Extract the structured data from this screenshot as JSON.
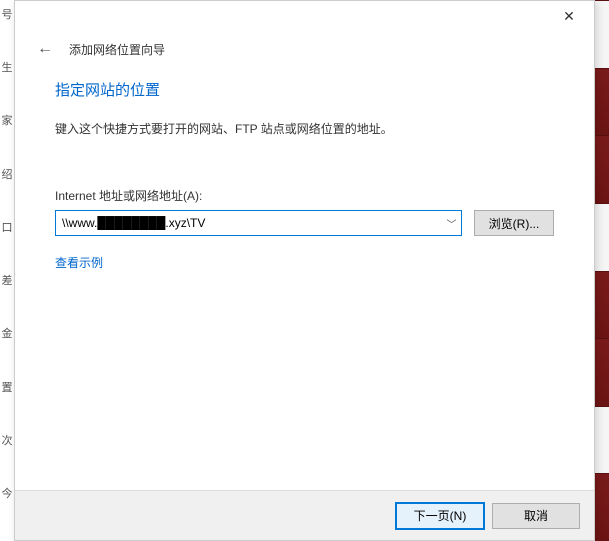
{
  "leftStrip": {
    "chars": [
      "号",
      "生",
      "家",
      "绍",
      "口",
      "差",
      "金",
      "置",
      "次",
      "今"
    ]
  },
  "titlebar": {
    "close_glyph": "✕"
  },
  "header": {
    "back_glyph": "←",
    "wizard_title": "添加网络位置向导"
  },
  "content": {
    "heading": "指定网站的位置",
    "subtext": "键入这个快捷方式要打开的网站、FTP 站点或网络位置的地址。",
    "field_label": "Internet 地址或网络地址(A):",
    "address_prefix": "\\\\www.",
    "address_redacted": "████████",
    "address_suffix": ".xyz\\TV",
    "dropdown_glyph": "﹀",
    "browse_label": "浏览(R)...",
    "example_link": "查看示例"
  },
  "footer": {
    "next_label": "下一页(N)",
    "cancel_label": "取消"
  }
}
